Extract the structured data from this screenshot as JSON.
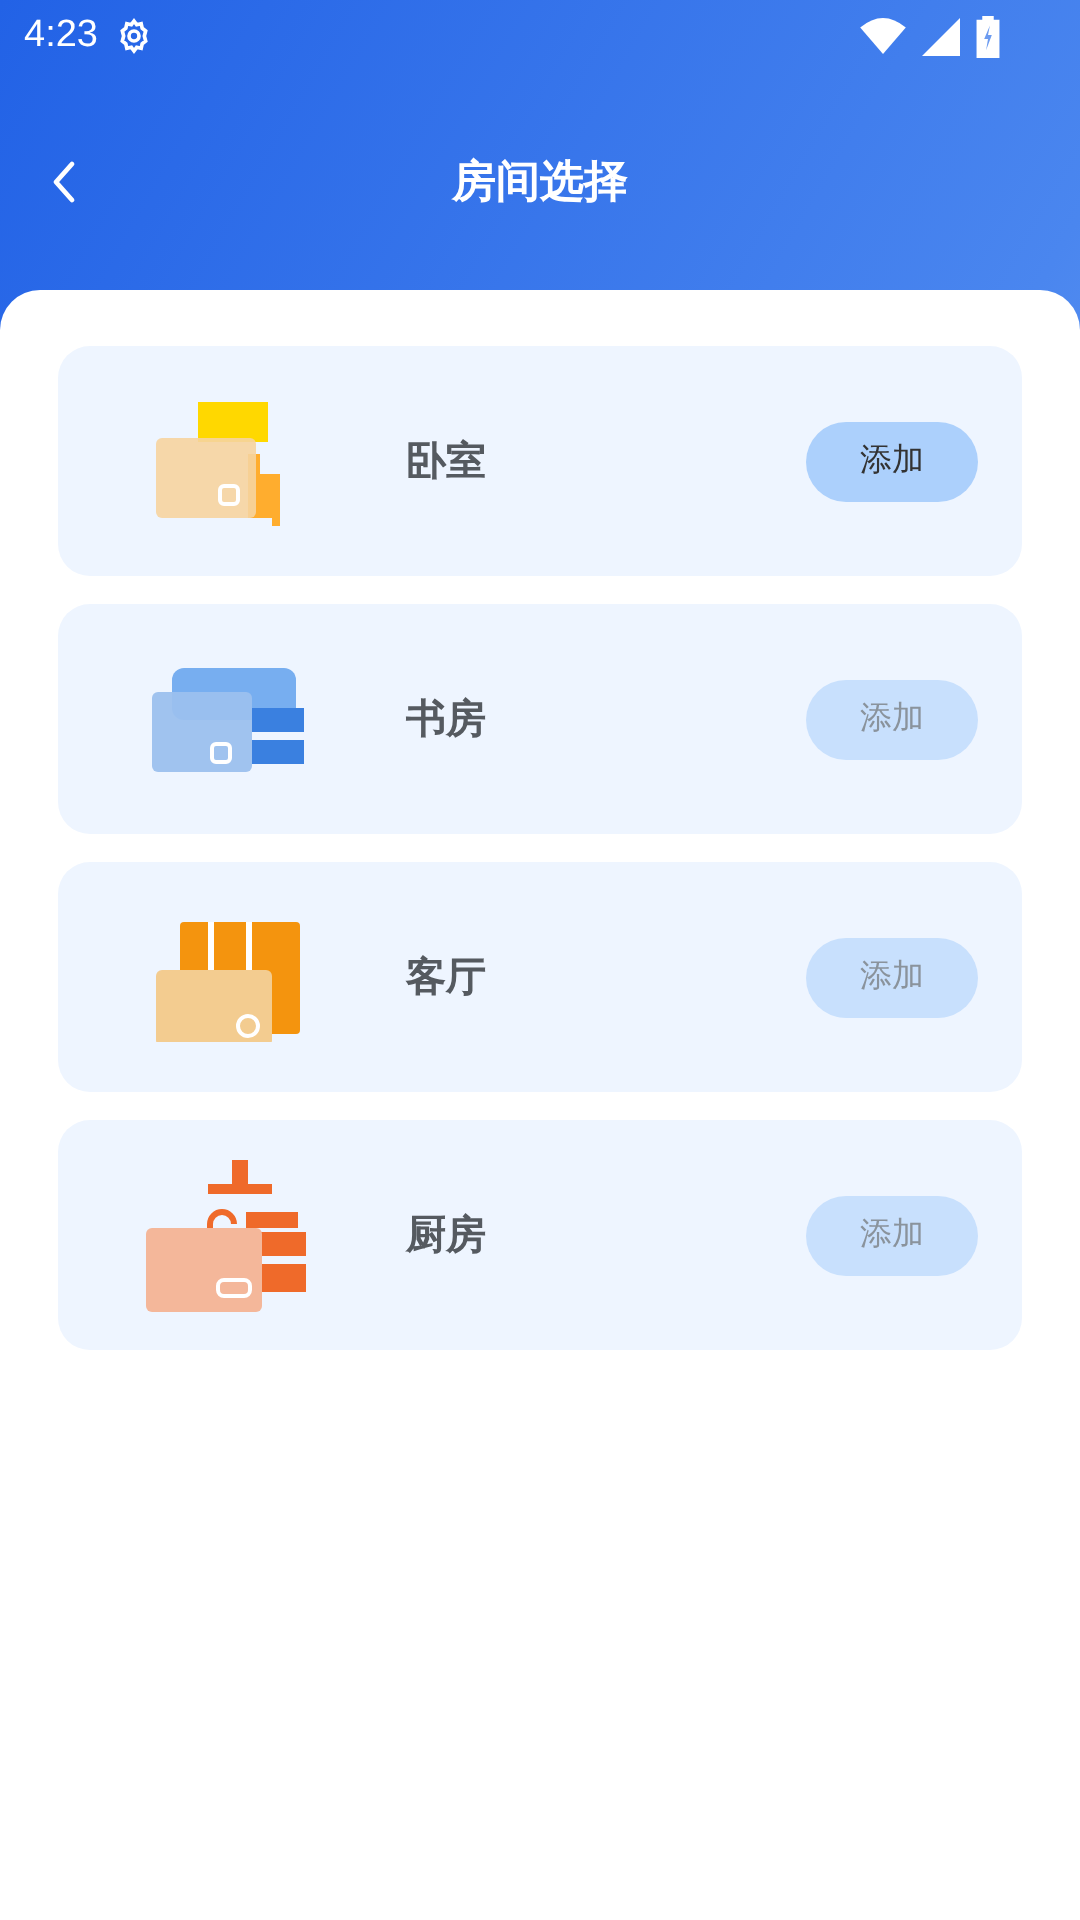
{
  "status_bar": {
    "time": "4:23"
  },
  "header": {
    "title": "房间选择"
  },
  "rooms": [
    {
      "kind": "bedroom",
      "name": "卧室",
      "button": "添加",
      "disabled": false
    },
    {
      "kind": "study",
      "name": "书房",
      "button": "添加",
      "disabled": true
    },
    {
      "kind": "living",
      "name": "客厅",
      "button": "添加",
      "disabled": true
    },
    {
      "kind": "kitchen",
      "name": "厨房",
      "button": "添加",
      "disabled": true
    }
  ]
}
